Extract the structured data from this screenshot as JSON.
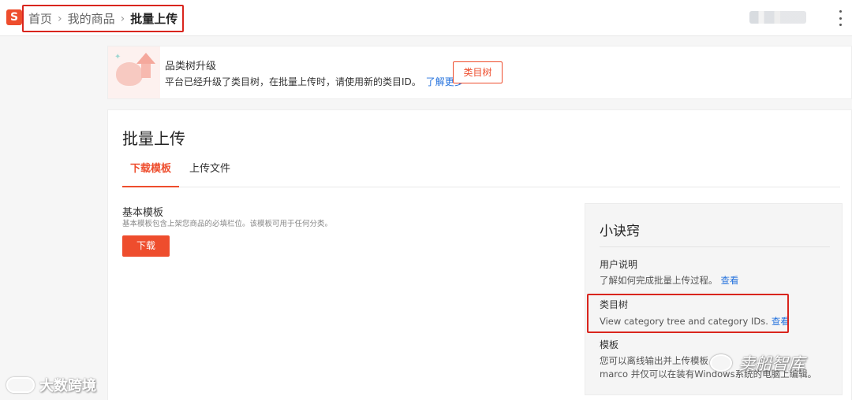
{
  "header": {
    "logo_letter": "S",
    "breadcrumb": [
      "首页",
      "我的商品",
      "批量上传"
    ],
    "separator": "›"
  },
  "banner": {
    "title": "品类树升级",
    "description": "平台已经升级了类目树，在批量上传时，请使用新的类目ID。",
    "link": "了解更多",
    "button": "类目树"
  },
  "main": {
    "title": "批量上传",
    "tabs": [
      {
        "label": "下载模板",
        "active": true
      },
      {
        "label": "上传文件",
        "active": false
      }
    ],
    "template": {
      "title": "基本模板",
      "description": "基本模板包含上架您商品的必填栏位。该模板可用于任何分类。",
      "button": "下载"
    }
  },
  "tips": {
    "title": "小诀窍",
    "items": [
      {
        "heading": "用户说明",
        "text": "了解如何完成批量上传过程。",
        "link": "查看"
      },
      {
        "heading": "类目树",
        "text": "View category tree and category IDs.",
        "link": "查看"
      },
      {
        "heading": "模板",
        "line1": "您可以离线输出并上传模板",
        "line2": "marco 并仅可以在装有Windows系统的电脑上编辑。"
      }
    ]
  },
  "watermarks": {
    "left": "大数跨境",
    "right": "卖船智库"
  },
  "colors": {
    "brand": "#ee4d2d",
    "link": "#2673dd",
    "highlight": "#d9251d"
  }
}
